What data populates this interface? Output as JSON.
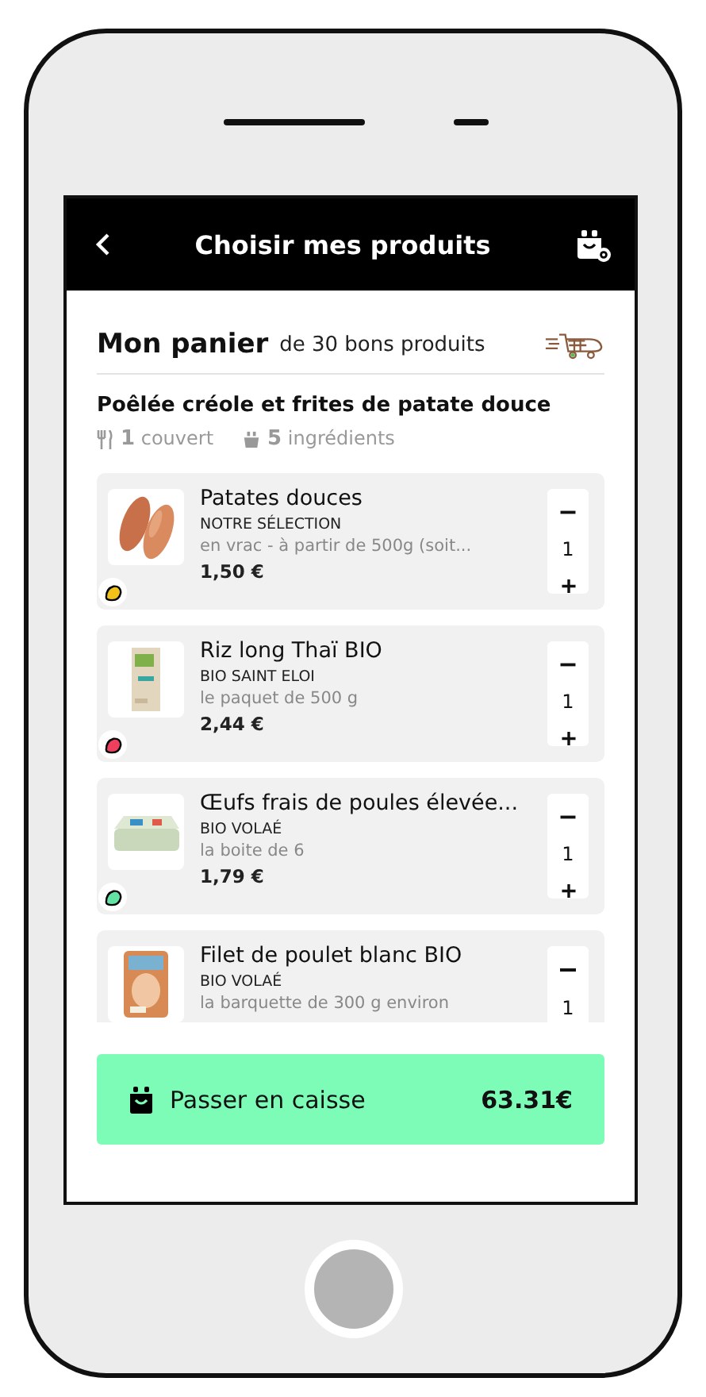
{
  "header": {
    "title": "Choisir mes produits"
  },
  "basket": {
    "title": "Mon panier",
    "subtitle": "de 30 bons produits"
  },
  "recipe": {
    "title": "Poêlée créole et frites de patate douce",
    "servings": {
      "count": "1",
      "label": "couvert"
    },
    "ingredients": {
      "count": "5",
      "label": "ingrédients"
    }
  },
  "products": [
    {
      "name": "Patates douces",
      "brand": "NOTRE SÉLECTION",
      "description": "en vrac - à partir de 500g (soit...",
      "price": "1,50 €",
      "quantity": "1",
      "color": "#f2c21b"
    },
    {
      "name": "Riz long Thaï BIO",
      "brand": "BIO SAINT ELOI",
      "description": "le paquet de 500 g",
      "price": "2,44 €",
      "quantity": "1",
      "color": "#ee3f5e"
    },
    {
      "name": "Œufs frais de poules élevée...",
      "brand": "BIO VOLAÉ",
      "description": "la boite de 6",
      "price": "1,79 €",
      "quantity": "1",
      "color": "#63e3a3"
    },
    {
      "name": "Filet de poulet blanc BIO",
      "brand": "BIO VOLAÉ",
      "description": "la barquette de 300 g environ",
      "quantity": "1"
    }
  ],
  "checkout": {
    "label": "Passer en caisse",
    "total": "63.31€"
  }
}
